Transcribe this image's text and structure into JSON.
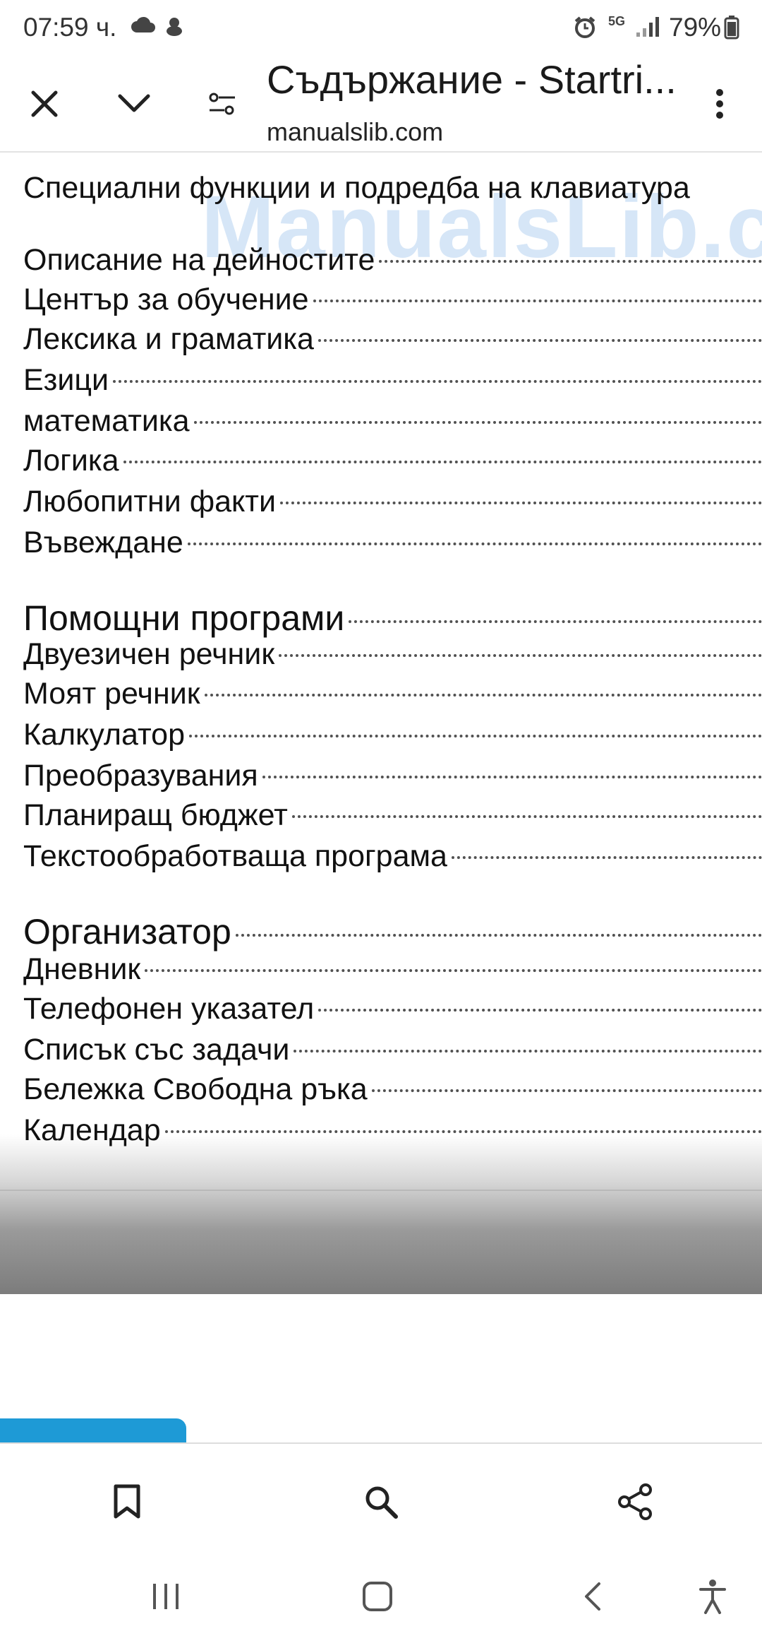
{
  "status_bar": {
    "time": "07:59 ч.",
    "network": "5G",
    "battery": "79%",
    "icons": [
      "cloud-icon",
      "notification-icon",
      "alarm-icon",
      "signal-icon",
      "battery-icon"
    ]
  },
  "header": {
    "title": "Съдържание - Startri...",
    "url": "manualslib.com",
    "icons": [
      "close-icon",
      "chevron-down-icon",
      "tune-icon",
      "more-vert-icon"
    ]
  },
  "document": {
    "watermark": "ManualsLib.c",
    "toc": [
      {
        "label": "Специални функции и подредба на клавиатура",
        "size": "md"
      },
      {
        "label": "Описание на дейностите",
        "size": "md"
      },
      {
        "label": "Център за обучение",
        "size": "md"
      },
      {
        "label": "Лексика и граматика",
        "size": "md"
      },
      {
        "label": "Езици",
        "size": "md"
      },
      {
        "label": "математика",
        "size": "md"
      },
      {
        "label": "Логика",
        "size": "md"
      },
      {
        "label": "Любопитни факти",
        "size": "md"
      },
      {
        "label": "Въвеждане",
        "size": "md"
      },
      {
        "label": "Помощни програми",
        "size": "lg"
      },
      {
        "label": "Двуезичен речник",
        "size": "md"
      },
      {
        "label": "Моят речник",
        "size": "md"
      },
      {
        "label": "Калкулатор",
        "size": "md"
      },
      {
        "label": "Преобразувания",
        "size": "md"
      },
      {
        "label": "Планиращ бюджет",
        "size": "md"
      },
      {
        "label": "Текстообработваща програма",
        "size": "md"
      },
      {
        "label": "Организатор",
        "size": "lg"
      },
      {
        "label": "Дневник",
        "size": "md"
      },
      {
        "label": "Телефонен указател",
        "size": "md"
      },
      {
        "label": "Списък със задачи",
        "size": "md"
      },
      {
        "label": "Бележка Свободна ръка",
        "size": "md"
      },
      {
        "label": "Календар",
        "size": "md"
      }
    ]
  },
  "bottom_bar": {
    "icons": [
      "bookmark-icon",
      "search-icon",
      "share-icon"
    ]
  },
  "nav_bar": {
    "icons": [
      "recents-icon",
      "home-icon",
      "back-icon",
      "accessibility-icon"
    ]
  },
  "colors": {
    "accent_tab": "#1e9ad6",
    "watermark": "#468cdc"
  }
}
